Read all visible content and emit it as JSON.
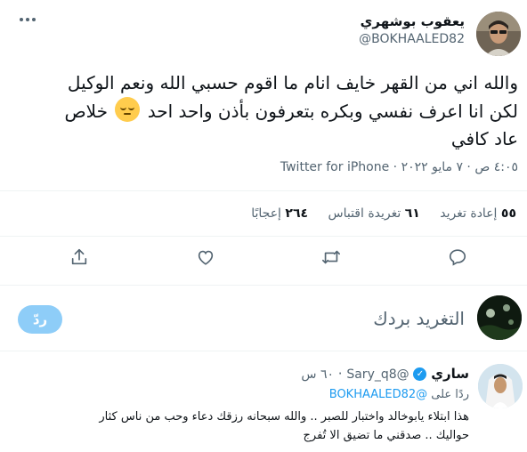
{
  "header": {
    "display_name": "يعقوب بوشهري",
    "handle": "@BOKHAALED82",
    "more_icon": "more-horizontal-icon"
  },
  "tweet": {
    "line1": "والله اني من القهر خايف انام ما اقوم حسبي الله ونعم الوكيل",
    "line2_before": "لكن انا اعرف نفسي وبكره بتعرفون بأذن واحد احد",
    "line2_after": "خلاص",
    "line3": "عاد كافي",
    "emoji": "pensive-face-emoji",
    "timestamp": "٤:٠٥ ص · ٧ مايو ٢٠٢٢ ·",
    "source": "Twitter for iPhone"
  },
  "stats": {
    "retweets_count": "٥٥",
    "retweets_label": "إعادة تغريد",
    "quotes_count": "٦١",
    "quotes_label": "تغريدة اقتباس",
    "likes_count": "٢٦٤",
    "likes_label": "إعجابًا"
  },
  "actions": {
    "icons": [
      "reply-icon",
      "retweet-icon",
      "like-icon",
      "share-icon"
    ]
  },
  "composer": {
    "placeholder": "التغريد بردك",
    "reply_button": "ردّ"
  },
  "reply": {
    "display_name": "ساري",
    "handle": "@Sary_q8",
    "time": "٦٠ س",
    "replying_to_label": "ردًا على",
    "replying_to_handle": "@BOKHAALED82",
    "line1": "هذا ابتلاء يابوخالد واختبار للصبر .. والله سبحانه رزقك دعاء وحب من ناس كثار",
    "line2": "حواليك .. صدقني ما تضيق الا تُفرج"
  },
  "colors": {
    "accent": "#1d9bf0",
    "text": "#0f1419",
    "muted": "#536471",
    "divider": "#eff3f4",
    "disabled_button": "#8ecdf8"
  }
}
